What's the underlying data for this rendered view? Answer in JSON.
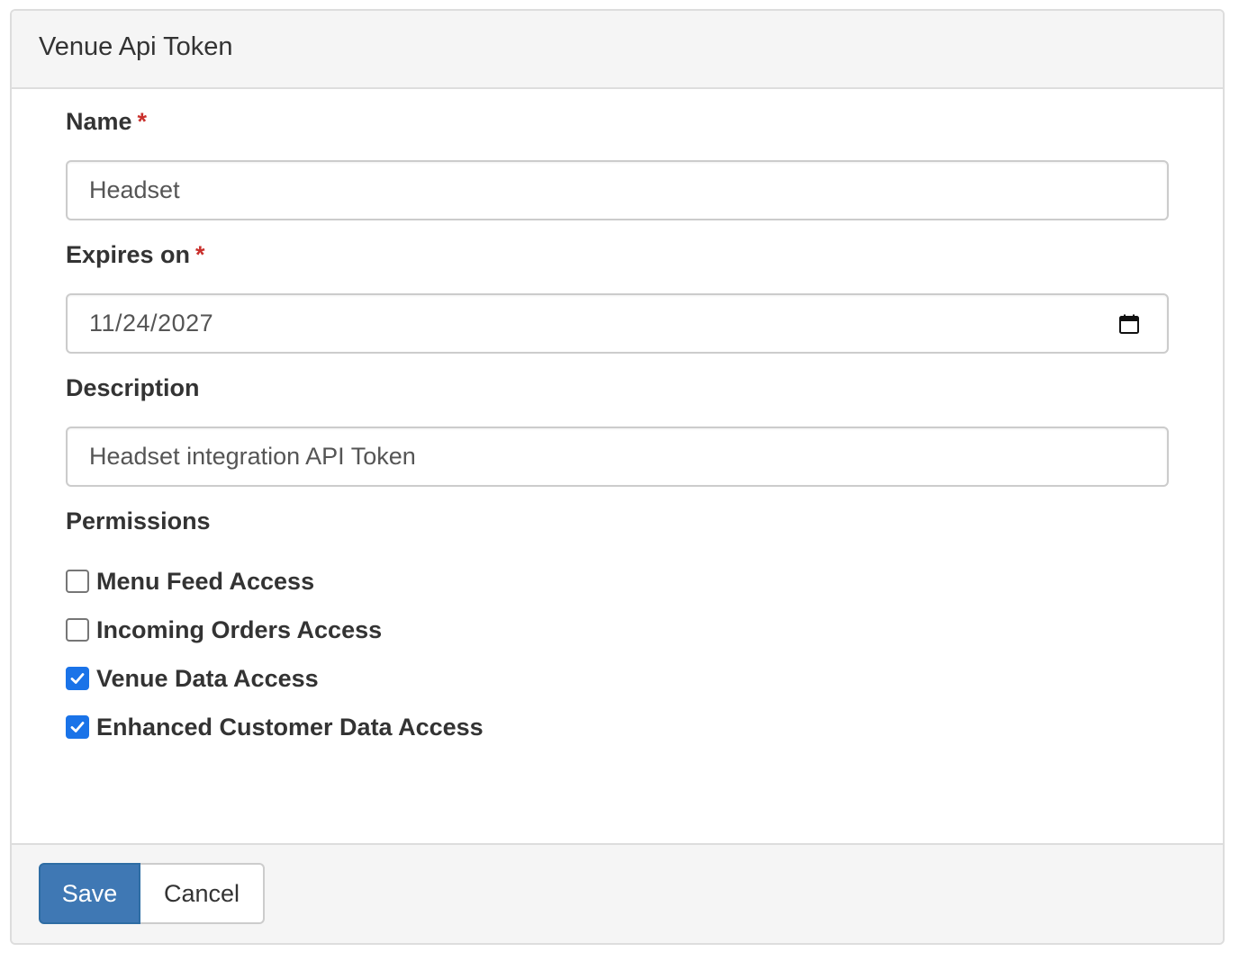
{
  "panel": {
    "title": "Venue Api Token"
  },
  "form": {
    "name": {
      "label": "Name",
      "required_mark": "*",
      "value": "Headset"
    },
    "expires_on": {
      "label": "Expires on",
      "required_mark": "*",
      "value": "11/24/2027",
      "icon": "calendar-icon"
    },
    "description": {
      "label": "Description",
      "value": "Headset integration API Token"
    },
    "permissions": {
      "label": "Permissions",
      "items": [
        {
          "label": "Menu Feed Access",
          "checked": false
        },
        {
          "label": "Incoming Orders Access",
          "checked": false
        },
        {
          "label": "Venue Data Access",
          "checked": true
        },
        {
          "label": "Enhanced Customer Data Access",
          "checked": true
        }
      ]
    }
  },
  "footer": {
    "save_label": "Save",
    "cancel_label": "Cancel"
  },
  "colors": {
    "primary": "#3f78b4",
    "checkbox_checked": "#1a73e8",
    "required": "#c9302c"
  }
}
